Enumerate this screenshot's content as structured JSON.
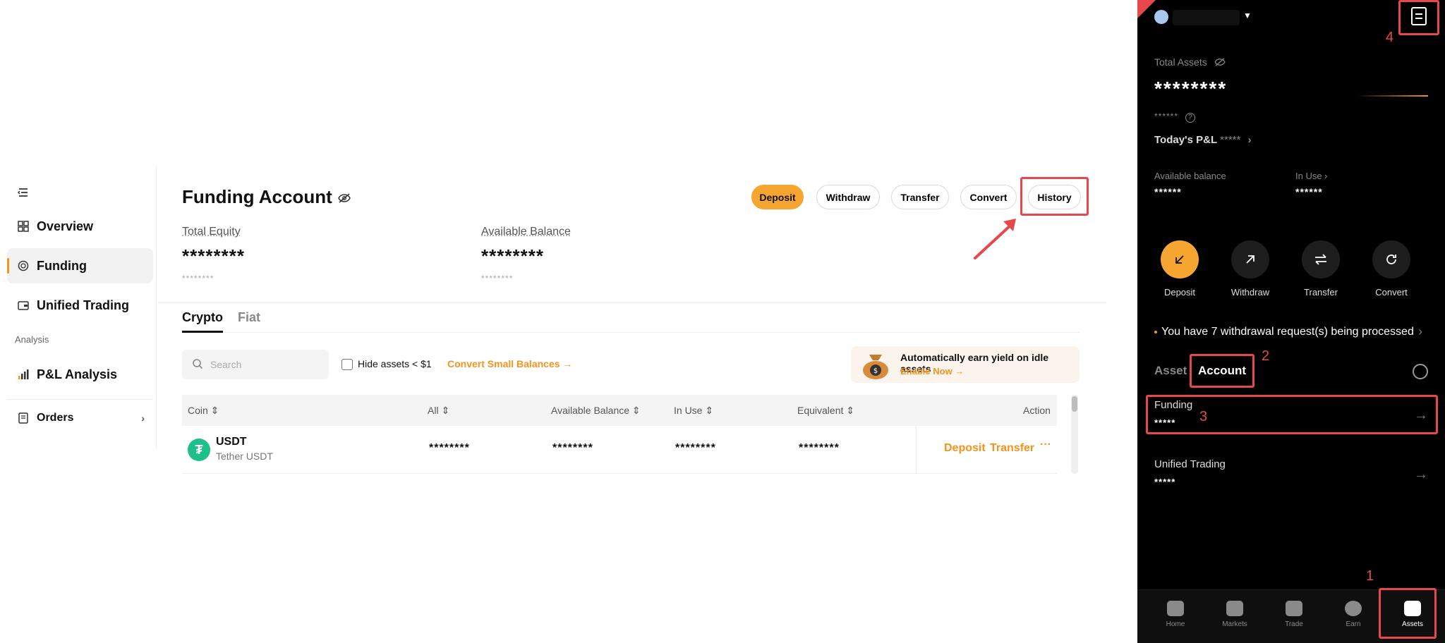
{
  "sidebar": {
    "items": [
      {
        "label": "Overview"
      },
      {
        "label": "Funding"
      },
      {
        "label": "Unified Trading"
      },
      {
        "label": "P&L Analysis"
      },
      {
        "label": "Orders"
      }
    ],
    "section_analysis": "Analysis"
  },
  "header": {
    "title": "Funding Account",
    "buttons": {
      "deposit": "Deposit",
      "withdraw": "Withdraw",
      "transfer": "Transfer",
      "convert": "Convert",
      "history": "History"
    }
  },
  "summary": {
    "total_equity_label": "Total Equity",
    "total_equity_value": "********",
    "total_equity_sub": "********",
    "available_label": "Available Balance",
    "available_value": "********",
    "available_sub": "********"
  },
  "tabs": {
    "crypto": "Crypto",
    "fiat": "Fiat"
  },
  "filters": {
    "search_placeholder": "Search",
    "hide_assets": "Hide assets < $1",
    "convert_small": "Convert Small Balances →"
  },
  "promo": {
    "title": "Automatically earn yield on idle assets",
    "cta": "Enable Now →"
  },
  "table": {
    "columns": [
      "Coin ⇕",
      "All ⇕",
      "Available Balance ⇕",
      "In Use ⇕",
      "Equivalent ⇕",
      "Action"
    ],
    "rows": [
      {
        "coin": "USDT",
        "coin_full": "Tether USDT",
        "coin_glyph": "₮",
        "all": "********",
        "available": "********",
        "in_use": "********",
        "equivalent": "********",
        "action_deposit": "Deposit",
        "action_transfer": "Transfer",
        "action_more": "···"
      }
    ]
  },
  "mobile": {
    "total_assets_label": "Total Assets",
    "total_assets_value": "********",
    "total_assets_sub": "******",
    "today_pl_label": "Today's P&L",
    "today_pl_value": "*****",
    "available_label": "Available balance",
    "available_value": "******",
    "in_use_label": "In Use ›",
    "in_use_value": "******",
    "actions": [
      {
        "label": "Deposit"
      },
      {
        "label": "Withdraw"
      },
      {
        "label": "Transfer"
      },
      {
        "label": "Convert"
      }
    ],
    "notice": "You have 7 withdrawal request(s) being processed",
    "tabs": {
      "asset": "Asset",
      "account": "Account"
    },
    "accounts": [
      {
        "name": "Funding",
        "value": "*****"
      },
      {
        "name": "Unified Trading",
        "value": "*****"
      }
    ],
    "nav": [
      {
        "label": "Home"
      },
      {
        "label": "Markets"
      },
      {
        "label": "Trade"
      },
      {
        "label": "Earn"
      },
      {
        "label": "Assets"
      }
    ]
  },
  "annotations": {
    "n1": "1",
    "n2": "2",
    "n3": "3",
    "n4": "4"
  },
  "colors": {
    "accent": "#f7a531",
    "annotation": "#e6484b",
    "coin_usdt": "#1ec08a"
  }
}
